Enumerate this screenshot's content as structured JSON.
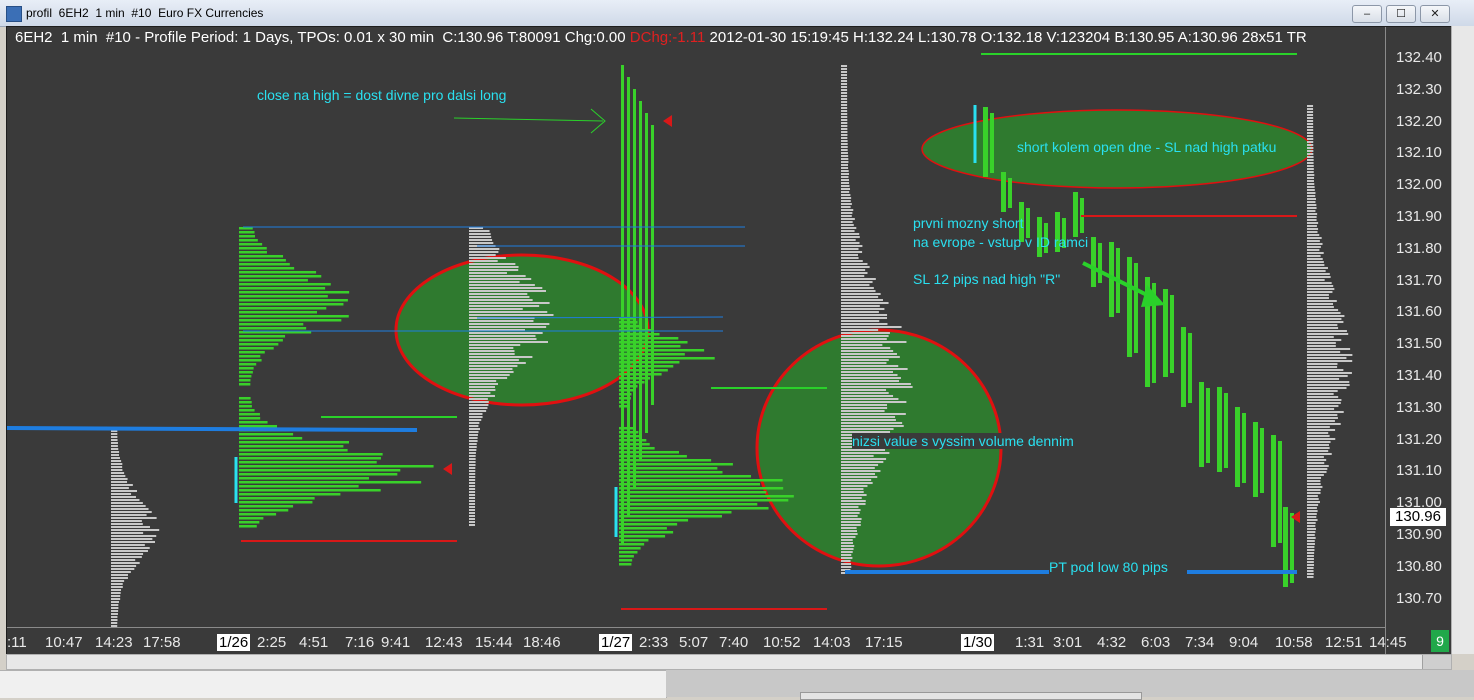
{
  "window": {
    "title": "profil  6EH2  1 min  #10  Euro FX Currencies",
    "minimize_label": "–",
    "restore_label": "☐",
    "close_label": "✕"
  },
  "chart": {
    "header_left": "6EH2  1 min  #10 - Profile Period: 1 Days, TPOs: 0.01 x 30 min  C:130.96 T:80091 Chg:0.00 ",
    "header_dchg": "DChg:-1.11",
    "header_right": " 2012-01-30 15:19:45 H:132.24 L:130.78 O:132.18 V:123204 B:130.95 A:130.96 28x51 TR",
    "price_ticks": [
      "132.40",
      "132.30",
      "132.20",
      "132.10",
      "132.00",
      "131.90",
      "131.80",
      "131.70",
      "131.60",
      "131.50",
      "131.40",
      "131.30",
      "131.20",
      "131.10",
      "131.00",
      "130.90",
      "130.80",
      "130.70"
    ],
    "current_price": "130.96",
    "time_ticks": [
      ":11",
      "10:47",
      "14:23",
      "17:58",
      "1/26",
      "2:25",
      "4:51",
      "7:16",
      "9:41",
      "12:43",
      "15:44",
      "18:46",
      "1/27",
      "2:33",
      "5:07",
      "7:40",
      "10:52",
      "14:03",
      "17:15",
      "1/30",
      "1:31",
      "3:01",
      "4:32",
      "6:03",
      "7:34",
      "9:04",
      "10:58",
      "12:51",
      "14:45"
    ],
    "day_markers": [
      "1/26",
      "1/27",
      "1/30"
    ],
    "corner_badge": "9",
    "annotations": {
      "close_high": "close na high = dost divne pro dalsi long",
      "short_open": "short kolem open dne - SL nad high patku",
      "prvni_line1": "prvni mozny short",
      "prvni_line2": "na evrope - vstup v ID ramci",
      "sl_12": "SL 12 pips nad high \"R\"",
      "nizsi": "nizsi value s vyssim volume dennim",
      "pt": "PT pod low 80 pips"
    },
    "colors": {
      "background": "#3a3a3a",
      "tpo_green": "#39d12a",
      "profile_grey": "#c8c8c8",
      "ellipse_fill": "#2f7a2f",
      "ellipse_red": "#e01010",
      "blue_line": "#1e7de0",
      "annotation_cyan": "#2ae0f0",
      "red_line": "#d81818"
    }
  }
}
